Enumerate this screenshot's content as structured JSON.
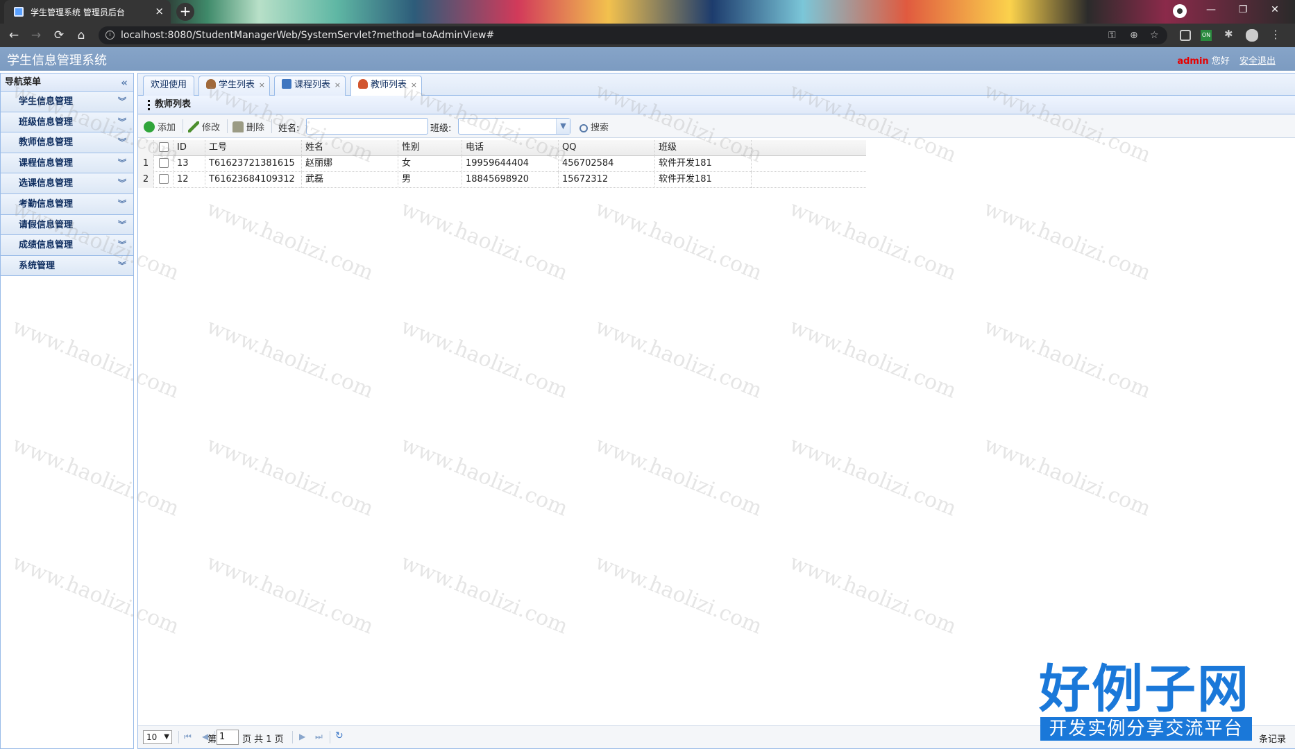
{
  "browser": {
    "tab_title": "学生管理系统 管理员后台",
    "tab_close": "×",
    "new_tab": "+",
    "url": "localhost:8080/StudentManagerWeb/SystemServlet?method=toAdminView#",
    "window_controls": {
      "minimize": "—",
      "restore": "❐",
      "close": "✕"
    },
    "nav": {
      "back": "←",
      "forward": "→",
      "reload": "⟳",
      "home": "⌂"
    },
    "extension_badge": "ON"
  },
  "app": {
    "title": "学生信息管理系统",
    "user": "admin",
    "greeting": "您好",
    "logout": "安全退出"
  },
  "sidebar": {
    "title": "导航菜单",
    "collapse_icon": "«",
    "items": [
      {
        "label": "学生信息管理"
      },
      {
        "label": "班级信息管理"
      },
      {
        "label": "教师信息管理"
      },
      {
        "label": "课程信息管理"
      },
      {
        "label": "选课信息管理"
      },
      {
        "label": "考勤信息管理"
      },
      {
        "label": "请假信息管理"
      },
      {
        "label": "成绩信息管理"
      },
      {
        "label": "系统管理"
      }
    ]
  },
  "tabs": [
    {
      "label": "欢迎使用",
      "closable": false
    },
    {
      "label": "学生列表",
      "closable": true,
      "icon": "user-icon"
    },
    {
      "label": "课程列表",
      "closable": true,
      "icon": "book-icon"
    },
    {
      "label": "教师列表",
      "closable": true,
      "icon": "teacher-icon",
      "active": true
    }
  ],
  "panel": {
    "title": "教师列表"
  },
  "toolbar": {
    "add_label": "添加",
    "edit_label": "修改",
    "delete_label": "删除",
    "name_label": "姓名:",
    "name_value": "",
    "class_label": "班级:",
    "class_value": "",
    "search_label": "搜索"
  },
  "grid": {
    "columns": [
      "ID",
      "工号",
      "姓名",
      "性别",
      "电话",
      "QQ",
      "班级"
    ],
    "rows": [
      {
        "rownum": "1",
        "id": "13",
        "sn": "T61623721381615",
        "name": "赵丽娜",
        "sex": "女",
        "phone": "19959644404",
        "qq": "456702584",
        "clazz": "软件开发181"
      },
      {
        "rownum": "2",
        "id": "12",
        "sn": "T61623684109312",
        "name": "武磊",
        "sex": "男",
        "phone": "18845698920",
        "qq": "15672312",
        "clazz": "软件开发181"
      }
    ]
  },
  "pager": {
    "page_size": "10",
    "page_prefix": "第",
    "page_value": "1",
    "page_suffix": "页 共 1 页",
    "records": "条记录"
  },
  "watermark": {
    "text": "www.haolizi.com",
    "logo_main": "好例子网",
    "logo_sub": "开发实例分享交流平台"
  },
  "colors": {
    "header_bg": "#7c9bc1",
    "panel_border": "#99bbe8",
    "logo_blue": "#1a78d9",
    "admin_red": "#e60000"
  }
}
